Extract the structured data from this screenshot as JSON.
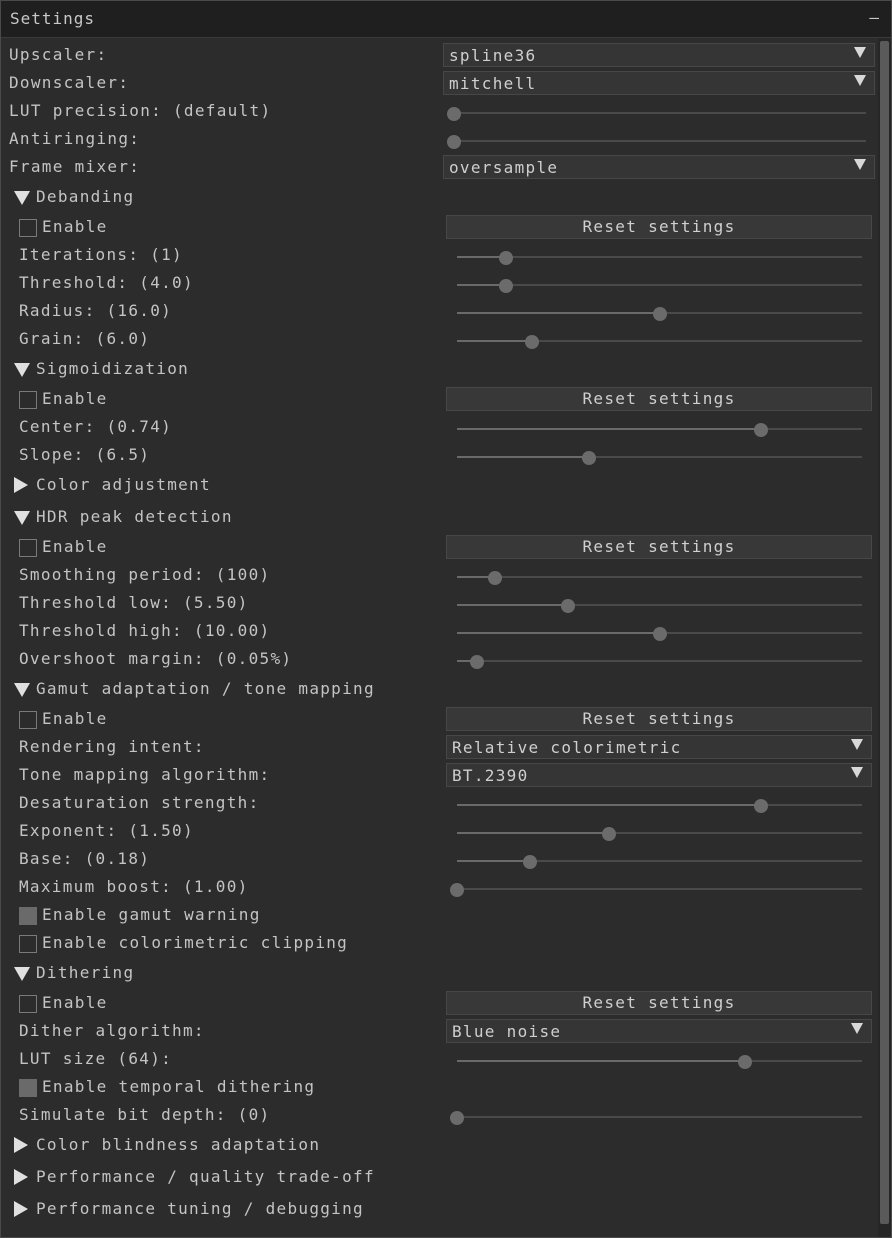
{
  "window": {
    "title": "Settings",
    "minimize": "–"
  },
  "top": {
    "upscaler_label": "Upscaler:",
    "upscaler_value": "spline36",
    "downscaler_label": "Downscaler:",
    "downscaler_value": "mitchell",
    "lut_label": "LUT precision: (default)",
    "lut_level": 0,
    "antiringing_label": "Antiringing:",
    "antiringing_level": 0,
    "mixer_label": "Frame mixer:",
    "mixer_value": "oversample"
  },
  "debanding": {
    "header": "Debanding",
    "expanded": true,
    "enable": "Enable",
    "enable_checked": false,
    "reset": "Reset settings",
    "iterations": "Iterations: (1)",
    "iterations_level": 0.12,
    "threshold": "Threshold: (4.0)",
    "threshold_level": 0.12,
    "radius": "Radius: (16.0)",
    "radius_level": 0.5,
    "grain": "Grain: (6.0)",
    "grain_level": 0.185
  },
  "sigmoid": {
    "header": "Sigmoidization",
    "expanded": true,
    "enable": "Enable",
    "enable_checked": false,
    "reset": "Reset settings",
    "center": "Center: (0.74)",
    "center_level": 0.75,
    "slope": "Slope: (6.5)",
    "slope_level": 0.325
  },
  "color_adjust": {
    "header": "Color adjustment",
    "expanded": false
  },
  "hdr": {
    "header": "HDR peak detection",
    "expanded": true,
    "enable": "Enable",
    "enable_checked": false,
    "reset": "Reset settings",
    "smoothing": "Smoothing period: (100)",
    "smoothing_level": 0.095,
    "low": "Threshold low: (5.50)",
    "low_level": 0.275,
    "high": "Threshold high: (10.00)",
    "high_level": 0.5,
    "overshoot": "Overshoot margin: (0.05%)",
    "overshoot_level": 0.05
  },
  "gamut": {
    "header": "Gamut adaptation / tone mapping",
    "expanded": true,
    "enable": "Enable",
    "enable_checked": false,
    "reset": "Reset settings",
    "intent_label": "Rendering intent:",
    "intent_value": "Relative colorimetric",
    "algo_label": "Tone mapping algorithm:",
    "algo_value": "BT.2390",
    "desat": "Desaturation strength:",
    "desat_level": 0.75,
    "exponent": "Exponent: (1.50)",
    "exponent_level": 0.375,
    "base": "Base: (0.18)",
    "base_level": 0.18,
    "boost": "Maximum boost: (1.00)",
    "boost_level": 0,
    "warning": "Enable gamut warning",
    "warning_checked": true,
    "clipping": "Enable colorimetric clipping",
    "clipping_checked": false
  },
  "dithering": {
    "header": "Dithering",
    "expanded": true,
    "enable": "Enable",
    "enable_checked": false,
    "reset": "Reset settings",
    "algo_label": "Dither algorithm:",
    "algo_value": "Blue noise",
    "lut": "LUT size (64):",
    "lut_level": 0.71,
    "temporal": "Enable temporal dithering",
    "temporal_checked": true,
    "bitdepth": "Simulate bit depth: (0)",
    "bitdepth_level": 0
  },
  "collapsed": {
    "blindness": "Color blindness adaptation",
    "perf_quality": "Performance / quality trade-off",
    "perf_tuning": "Performance tuning / debugging"
  },
  "icons": {
    "expanded": "triangle-down-icon",
    "collapsed": "triangle-right-icon",
    "combo": "chevron-down-icon"
  },
  "colors": {
    "background": "#2c2c2c",
    "titlebar": "#1f1f1f",
    "widget": "#353535",
    "knob": "#6b6b6b",
    "text": "#c8c8c8"
  }
}
